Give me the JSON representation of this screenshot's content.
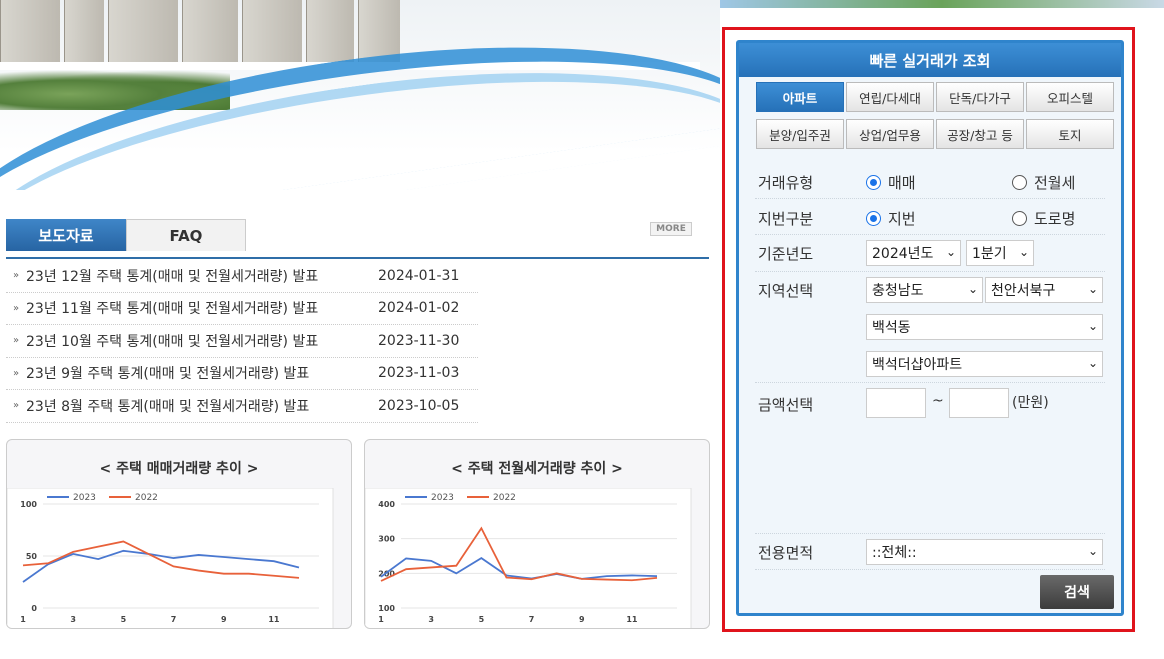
{
  "news_tabs": {
    "active": "보도자료",
    "inactive": "FAQ",
    "more": "MORE"
  },
  "news": [
    {
      "title": "23년 12월 주택 통계(매매 및 전월세거래량) 발표",
      "date": "2024-01-31"
    },
    {
      "title": "23년 11월 주택 통계(매매 및 전월세거래량) 발표",
      "date": "2024-01-02"
    },
    {
      "title": "23년 10월 주택 통계(매매 및 전월세거래량) 발표",
      "date": "2023-11-30"
    },
    {
      "title": "23년 9월 주택 통계(매매 및 전월세거래량) 발표",
      "date": "2023-11-03"
    },
    {
      "title": "23년 8월 주택 통계(매매 및 전월세거래량) 발표",
      "date": "2023-10-05"
    }
  ],
  "chart_data": [
    {
      "type": "line",
      "title": "< 주택 매매거래량 추이 >",
      "x": [
        1,
        2,
        3,
        4,
        5,
        6,
        7,
        8,
        9,
        10,
        11,
        12
      ],
      "x_ticks": [
        "1",
        "3",
        "5",
        "7",
        "9",
        "11"
      ],
      "y_ticks": [
        "0",
        "50",
        "100"
      ],
      "ylim": [
        0,
        100
      ],
      "legend": "top-left",
      "series": [
        {
          "name": "2023",
          "color": "#4a78d0",
          "values": [
            25,
            42,
            52,
            47,
            55,
            52,
            48,
            51,
            49,
            47,
            45,
            39
          ]
        },
        {
          "name": "2022",
          "color": "#e8613a",
          "values": [
            41,
            43,
            54,
            59,
            64,
            52,
            40,
            36,
            33,
            33,
            31,
            29
          ]
        }
      ]
    },
    {
      "type": "line",
      "title": "< 주택 전월세거래량 추이 >",
      "x": [
        1,
        2,
        3,
        4,
        5,
        6,
        7,
        8,
        9,
        10,
        11,
        12
      ],
      "x_ticks": [
        "1",
        "3",
        "5",
        "7",
        "9",
        "11"
      ],
      "y_ticks": [
        "100",
        "200",
        "300",
        "400"
      ],
      "ylim": [
        100,
        400
      ],
      "legend": "top-left",
      "series": [
        {
          "name": "2023",
          "color": "#4a78d0",
          "values": [
            190,
            243,
            236,
            200,
            244,
            194,
            185,
            198,
            184,
            192,
            194,
            192
          ]
        },
        {
          "name": "2022",
          "color": "#e8613a",
          "values": [
            178,
            212,
            217,
            222,
            330,
            188,
            183,
            200,
            184,
            182,
            180,
            187
          ]
        }
      ]
    }
  ],
  "panel": {
    "title": "빠른 실거래가 조회",
    "tabs_row1": [
      "아파트",
      "연립/다세대",
      "단독/다가구",
      "오피스텔"
    ],
    "tabs_row2": [
      "분양/입주권",
      "상업/업무용",
      "공장/창고 등",
      "토지"
    ],
    "deal_type": {
      "label": "거래유형",
      "options": [
        "매매",
        "전월세"
      ],
      "selected": "매매"
    },
    "lot_type": {
      "label": "지번구분",
      "options": [
        "지번",
        "도로명"
      ],
      "selected": "지번"
    },
    "base_year": {
      "label": "기준년도",
      "year": "2024년도",
      "quarter": "1분기"
    },
    "region": {
      "label": "지역선택",
      "province": "충청남도",
      "district": "천안서북구",
      "dong": "백석동",
      "complex": "백석더샵아파트"
    },
    "amount": {
      "label": "금액선택",
      "tilde": "~",
      "unit": "(만원)",
      "min": "",
      "max": ""
    },
    "area": {
      "label": "전용면적",
      "value": "::전체::"
    },
    "search_label": "검색"
  }
}
